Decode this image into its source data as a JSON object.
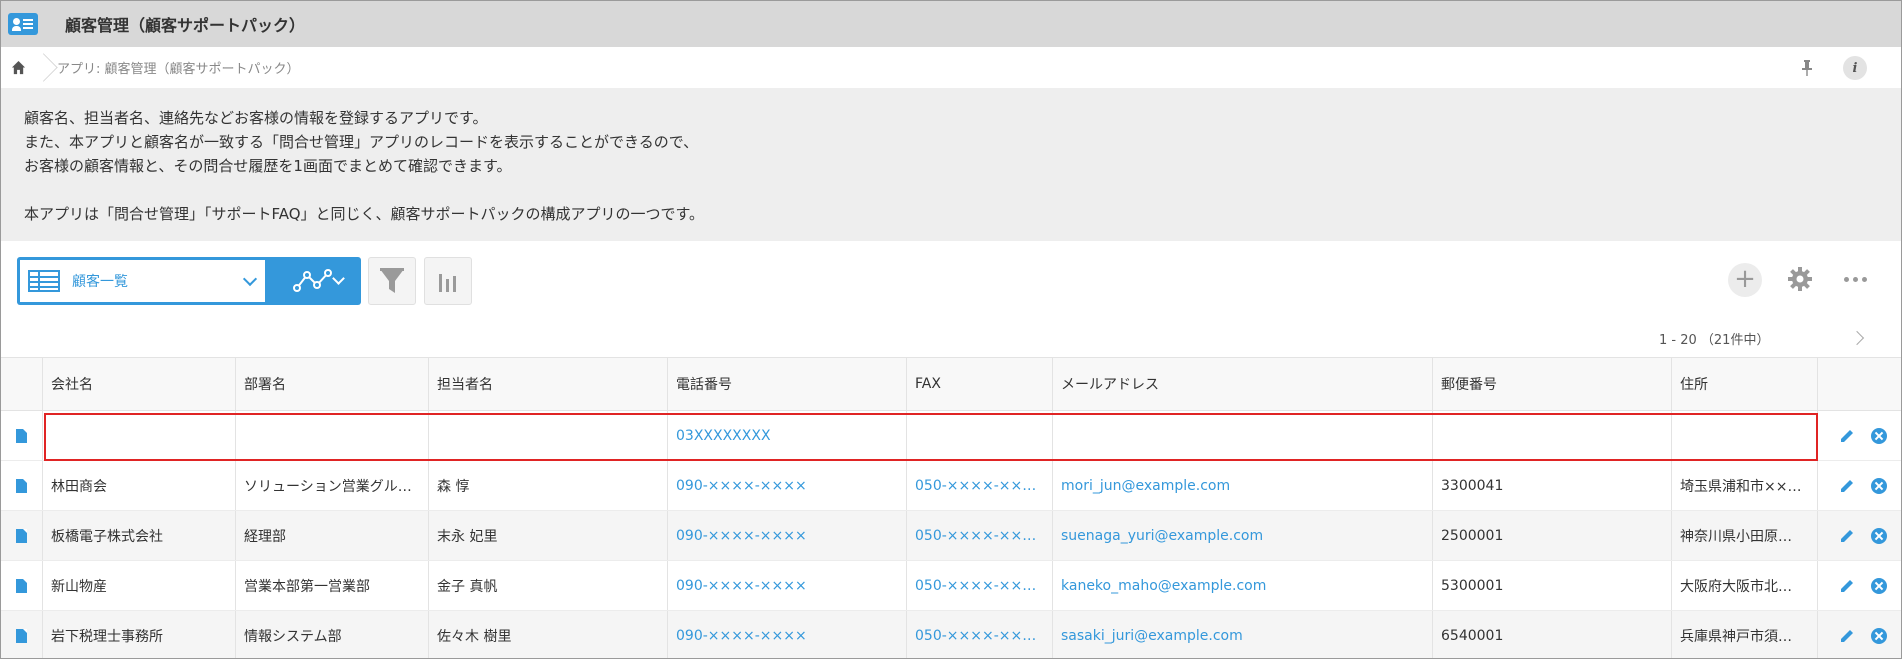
{
  "titlebar": {
    "title": "顧客管理（顧客サポートパック）",
    "icon": "customer-card-icon"
  },
  "breadcrumb": {
    "home_icon": "home-icon",
    "text": "アプリ: 顧客管理（顧客サポートパック）",
    "pin_icon": "pin-icon",
    "info_label": "i"
  },
  "description": {
    "lines": [
      "顧客名、担当者名、連絡先などお客様の情報を登録するアプリです。",
      "また、本アプリと顧客名が一致する「問合せ管理」アプリのレコードを表示することができるので、",
      "お客様の顧客情報と、その問合せ履歴を1画面でまとめて確認できます。",
      "本アプリは「問合せ管理」「サポートFAQ」と同じく、顧客サポートパックの構成アプリの一つです。"
    ]
  },
  "toolbar": {
    "view_label": "顧客一覧",
    "plus_label": "+",
    "accent_color": "#3498db"
  },
  "pager": {
    "text": "1 - 20 （21件中）"
  },
  "table": {
    "columns": [
      "会社名",
      "部署名",
      "担当者名",
      "電話番号",
      "FAX",
      "メールアドレス",
      "郵便番号",
      "住所"
    ],
    "rows": [
      [
        "",
        "",
        "",
        "03XXXXXXXX",
        "",
        "",
        "",
        ""
      ],
      [
        "林田商会",
        "ソリューション営業グル…",
        "森 惇",
        "090-××××-××××",
        "050-××××-××…",
        "mori_jun@example.com",
        "3300041",
        "埼玉県浦和市××…"
      ],
      [
        "板橋電子株式会社",
        "経理部",
        "末永 妃里",
        "090-××××-××××",
        "050-××××-××…",
        "suenaga_yuri@example.com",
        "2500001",
        "神奈川県小田原…"
      ],
      [
        "新山物産",
        "営業本部第一営業部",
        "金子 真帆",
        "090-××××-××××",
        "050-××××-××…",
        "kaneko_maho@example.com",
        "5300001",
        "大阪府大阪市北…"
      ],
      [
        "岩下税理士事務所",
        "情報システム部",
        "佐々木 樹里",
        "090-××××-××××",
        "050-××××-××…",
        "sasaki_juri@example.com",
        "6540001",
        "兵庫県神戸市須…"
      ]
    ]
  }
}
